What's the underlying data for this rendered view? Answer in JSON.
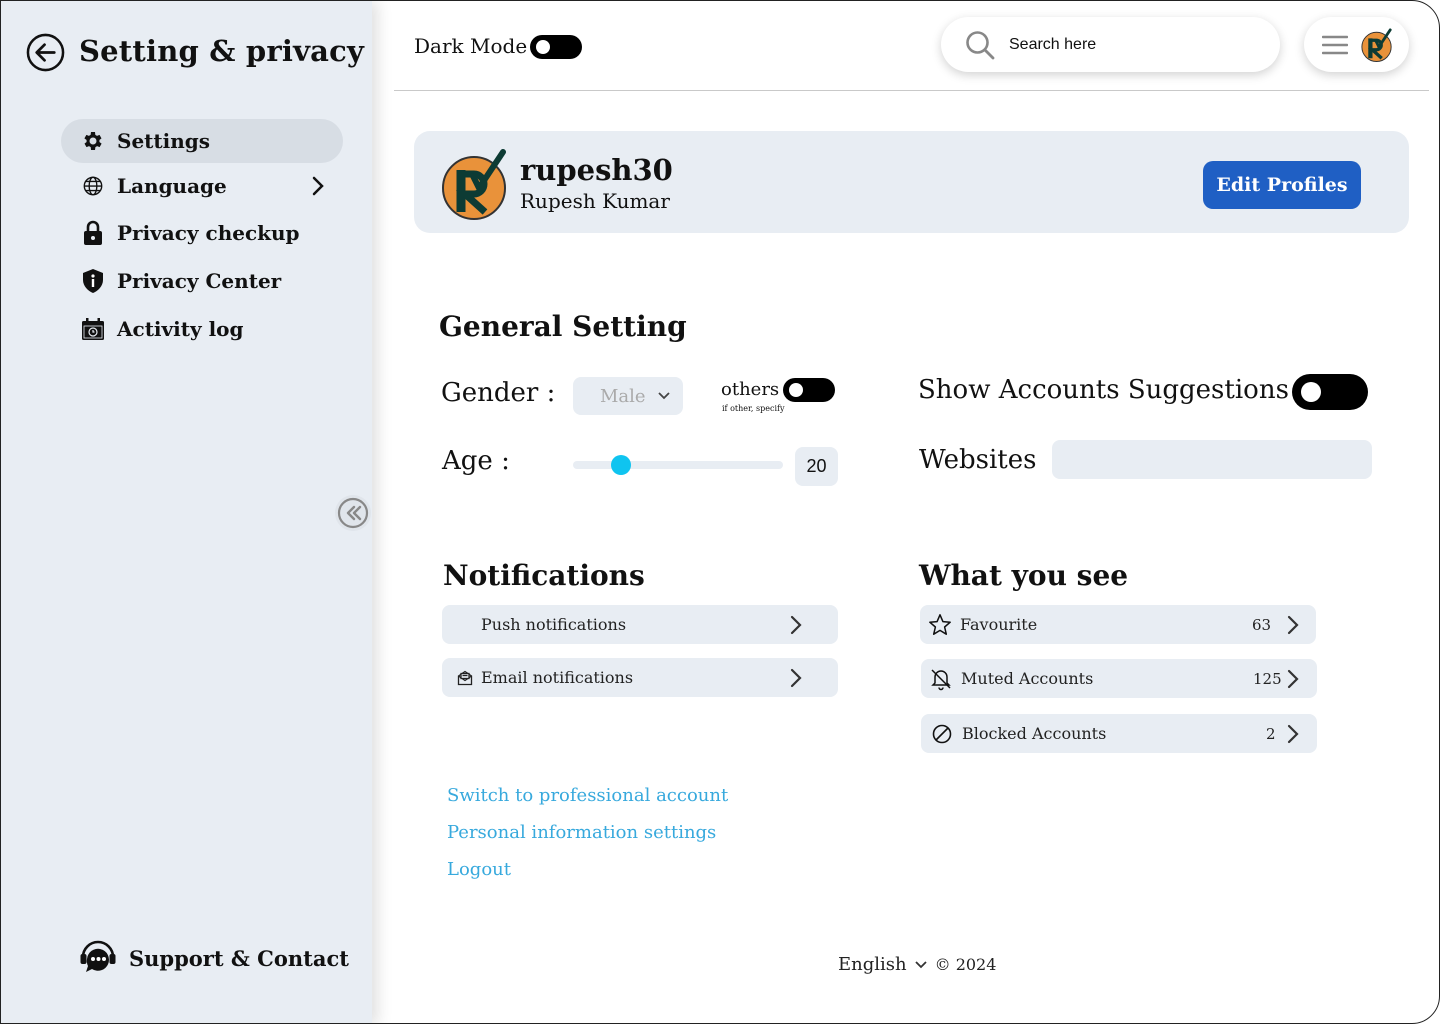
{
  "sidebar": {
    "title": "Setting & privacy",
    "items": [
      {
        "label": "Settings",
        "icon": "gear-icon",
        "active": true
      },
      {
        "label": "Language",
        "icon": "globe-icon"
      },
      {
        "label": "Privacy checkup",
        "icon": "lock-icon"
      },
      {
        "label": "Privacy Center",
        "icon": "shield-info-icon"
      },
      {
        "label": "Activity log",
        "icon": "calendar-icon"
      }
    ],
    "support_label": "Support & Contact"
  },
  "header": {
    "dark_mode_label": "Dark Mode",
    "search_placeholder": "Search here"
  },
  "profile": {
    "username": "rupesh30",
    "full_name": "Rupesh Kumar",
    "edit_button": "Edit Profiles"
  },
  "general": {
    "title": "General Setting",
    "gender_label": "Gender :",
    "gender_value": "Male",
    "others_label": "others",
    "others_hint": "if other, specify",
    "age_label": "Age :",
    "age_value": "20",
    "age_slider_fraction": 0.23,
    "suggestions_label": "Show Accounts Suggestions",
    "websites_label": "Websites"
  },
  "notifications": {
    "title": "Notifications",
    "items": [
      {
        "label": "Push notifications"
      },
      {
        "label": "Email notifications",
        "icon": "mail-open-icon"
      }
    ]
  },
  "what_you_see": {
    "title": "What you see",
    "items": [
      {
        "label": "Favourite",
        "count": "63",
        "icon": "star-icon"
      },
      {
        "label": "Muted Accounts",
        "count": "125",
        "icon": "bell-off-icon"
      },
      {
        "label": "Blocked Accounts",
        "count": "2",
        "icon": "block-icon"
      }
    ]
  },
  "links": [
    "Switch to professional account",
    "Personal information settings",
    "Logout"
  ],
  "footer": {
    "language": "English",
    "copyright": "© 2024"
  },
  "colors": {
    "accent": "#1f5fc4",
    "link": "#37a9dd",
    "panel": "#e8edf3",
    "slider": "#0fc4f0"
  }
}
